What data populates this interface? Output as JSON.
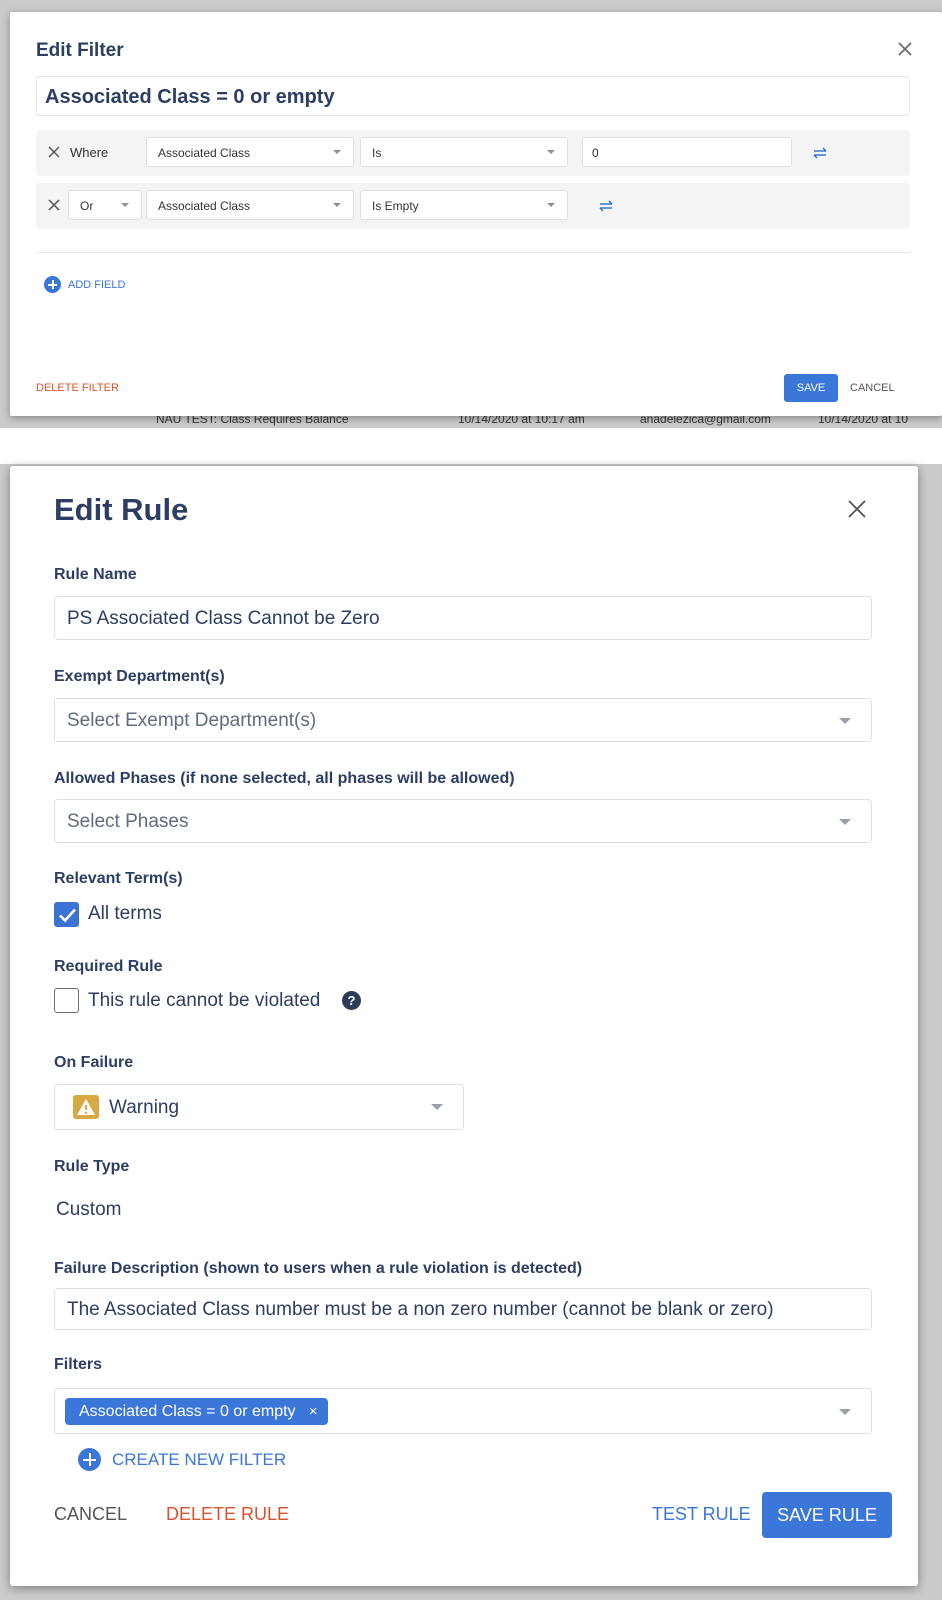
{
  "edit_filter": {
    "title": "Edit Filter",
    "filter_name": "Associated Class = 0 or empty",
    "conditions": [
      {
        "connector": "Where",
        "field": "Associated Class",
        "operator": "Is",
        "value": "0"
      },
      {
        "connector": "Or",
        "field": "Associated Class",
        "operator": "Is Empty"
      }
    ],
    "add_field_label": "ADD FIELD",
    "delete_label": "DELETE FILTER",
    "save_label": "SAVE",
    "cancel_label": "CANCEL"
  },
  "background_row": {
    "name": "NAU TEST: Class Requires Balance",
    "date1": "10/14/2020 at 10:17 am",
    "email": "anadelezica@gmail.com",
    "date2": "10/14/2020 at 10"
  },
  "edit_rule": {
    "title": "Edit Rule",
    "rule_name_label": "Rule Name",
    "rule_name_value": "PS Associated Class Cannot be Zero",
    "exempt_label": "Exempt Department(s)",
    "exempt_placeholder": "Select Exempt Department(s)",
    "phases_label": "Allowed Phases (if none selected, all phases will be allowed)",
    "phases_placeholder": "Select Phases",
    "terms_label": "Relevant Term(s)",
    "terms_checkbox_label": "All terms",
    "terms_checked": true,
    "required_label": "Required Rule",
    "required_checkbox_label": "This rule cannot be violated",
    "required_checked": false,
    "help_glyph": "?",
    "on_failure_label": "On Failure",
    "on_failure_value": "Warning",
    "rule_type_label": "Rule Type",
    "rule_type_value": "Custom",
    "failure_desc_label": "Failure Description (shown to users when a rule violation is detected)",
    "failure_desc_value": "The Associated Class number must be a non zero number (cannot be blank or zero)",
    "filters_label": "Filters",
    "filter_chip": "Associated Class = 0 or empty",
    "chip_remove": "×",
    "create_filter_label": "CREATE NEW FILTER",
    "cancel_label": "CANCEL",
    "delete_label": "DELETE RULE",
    "test_label": "TEST RULE",
    "save_label": "SAVE RULE"
  },
  "colors": {
    "primary": "#3a77d8",
    "danger": "#d9532c",
    "warning": "#d8a843",
    "heading": "#2c3e63"
  }
}
